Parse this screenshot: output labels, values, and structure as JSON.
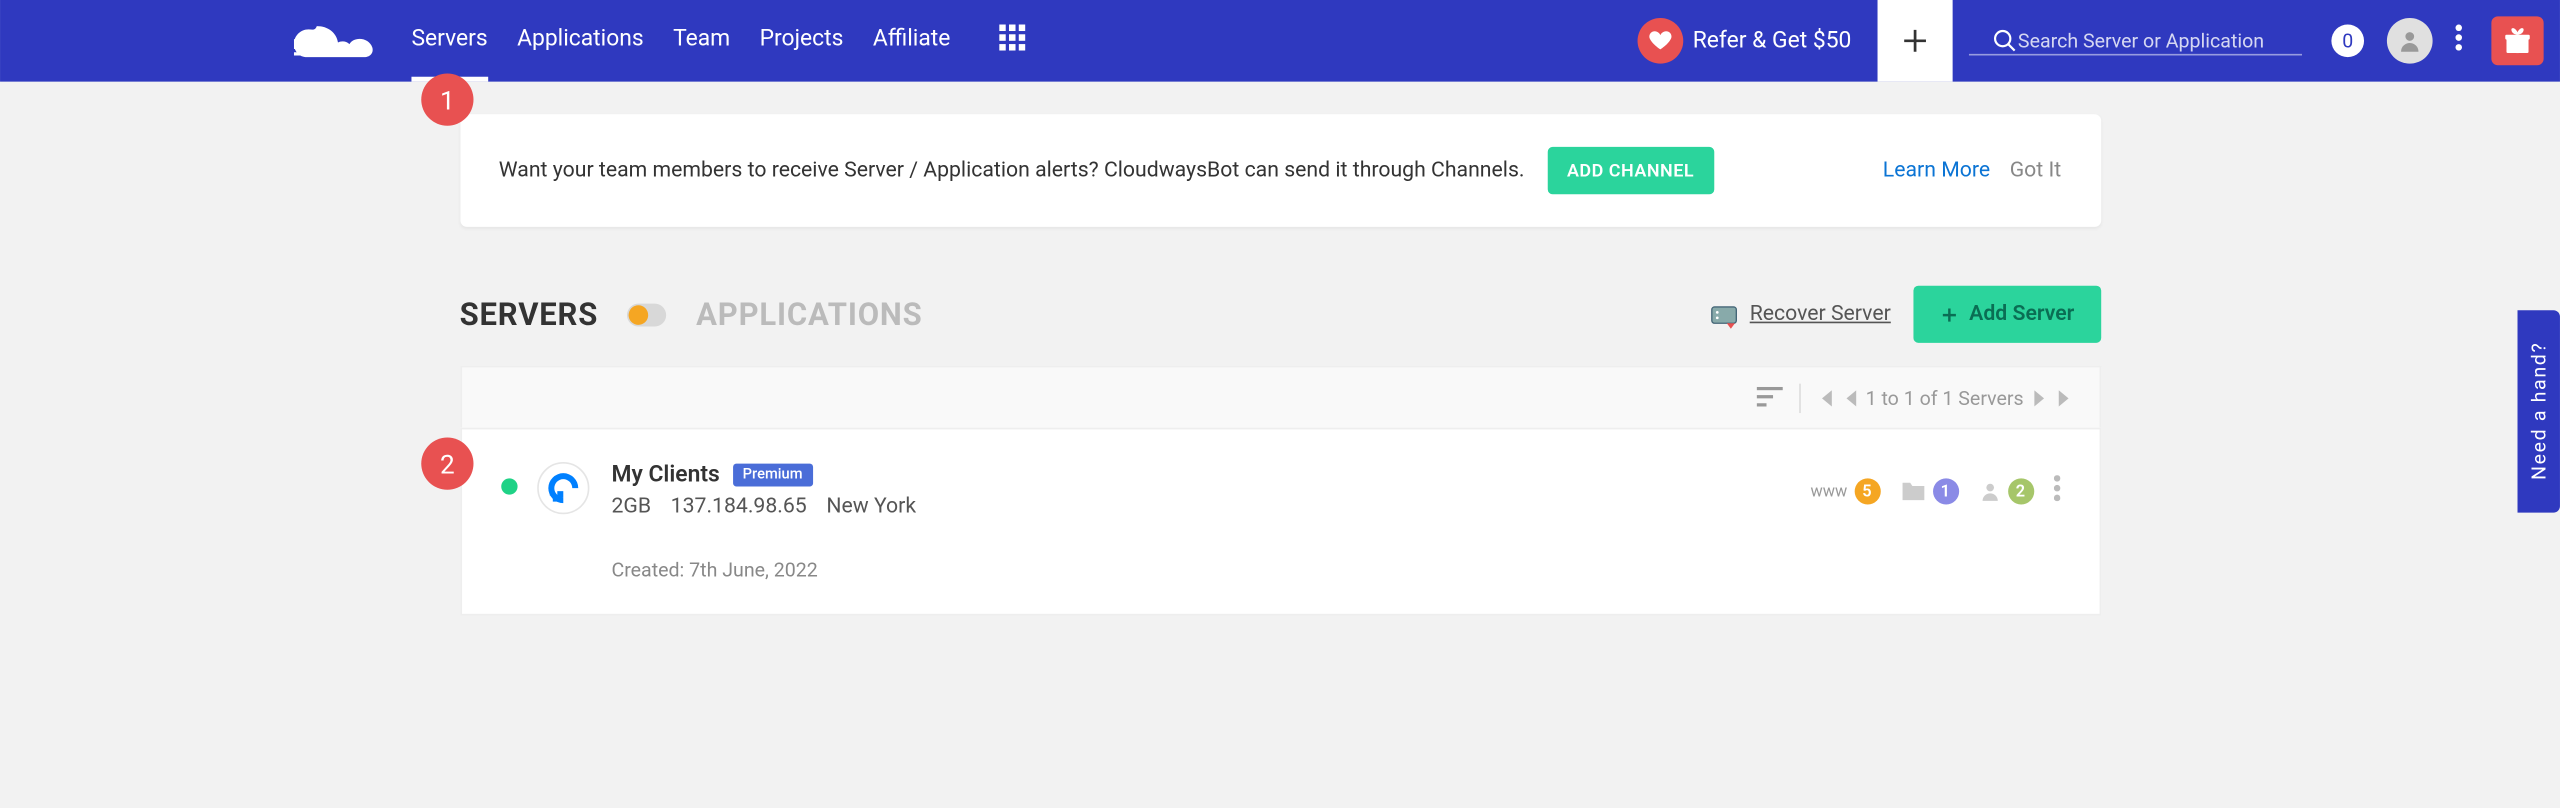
{
  "nav": {
    "servers": "Servers",
    "applications": "Applications",
    "team": "Team",
    "projects": "Projects",
    "affiliate": "Affiliate"
  },
  "header": {
    "refer": "Refer & Get $50",
    "search_placeholder": "Search Server or Application",
    "count": "0"
  },
  "notice": {
    "text": "Want your team members to receive Server / Application alerts? CloudwaysBot can send it through Channels.",
    "add_channel": "ADD CHANNEL",
    "learn": "Learn More",
    "gotit": "Got It"
  },
  "tabs": {
    "servers": "SERVERS",
    "apps": "APPLICATIONS"
  },
  "actions": {
    "recover": "Recover Server",
    "add_server": "Add Server"
  },
  "pagination": "1 to 1 of 1 Servers",
  "server": {
    "name": "My Clients",
    "badge": "Premium",
    "size": "2GB",
    "ip": "137.184.98.65",
    "location": "New York",
    "created": "Created: 7th June, 2022",
    "www_count": "5",
    "folder_count": "1",
    "user_count": "2"
  },
  "markers": {
    "m1": "1",
    "m2": "2"
  },
  "side_tab": "Need a hand?"
}
